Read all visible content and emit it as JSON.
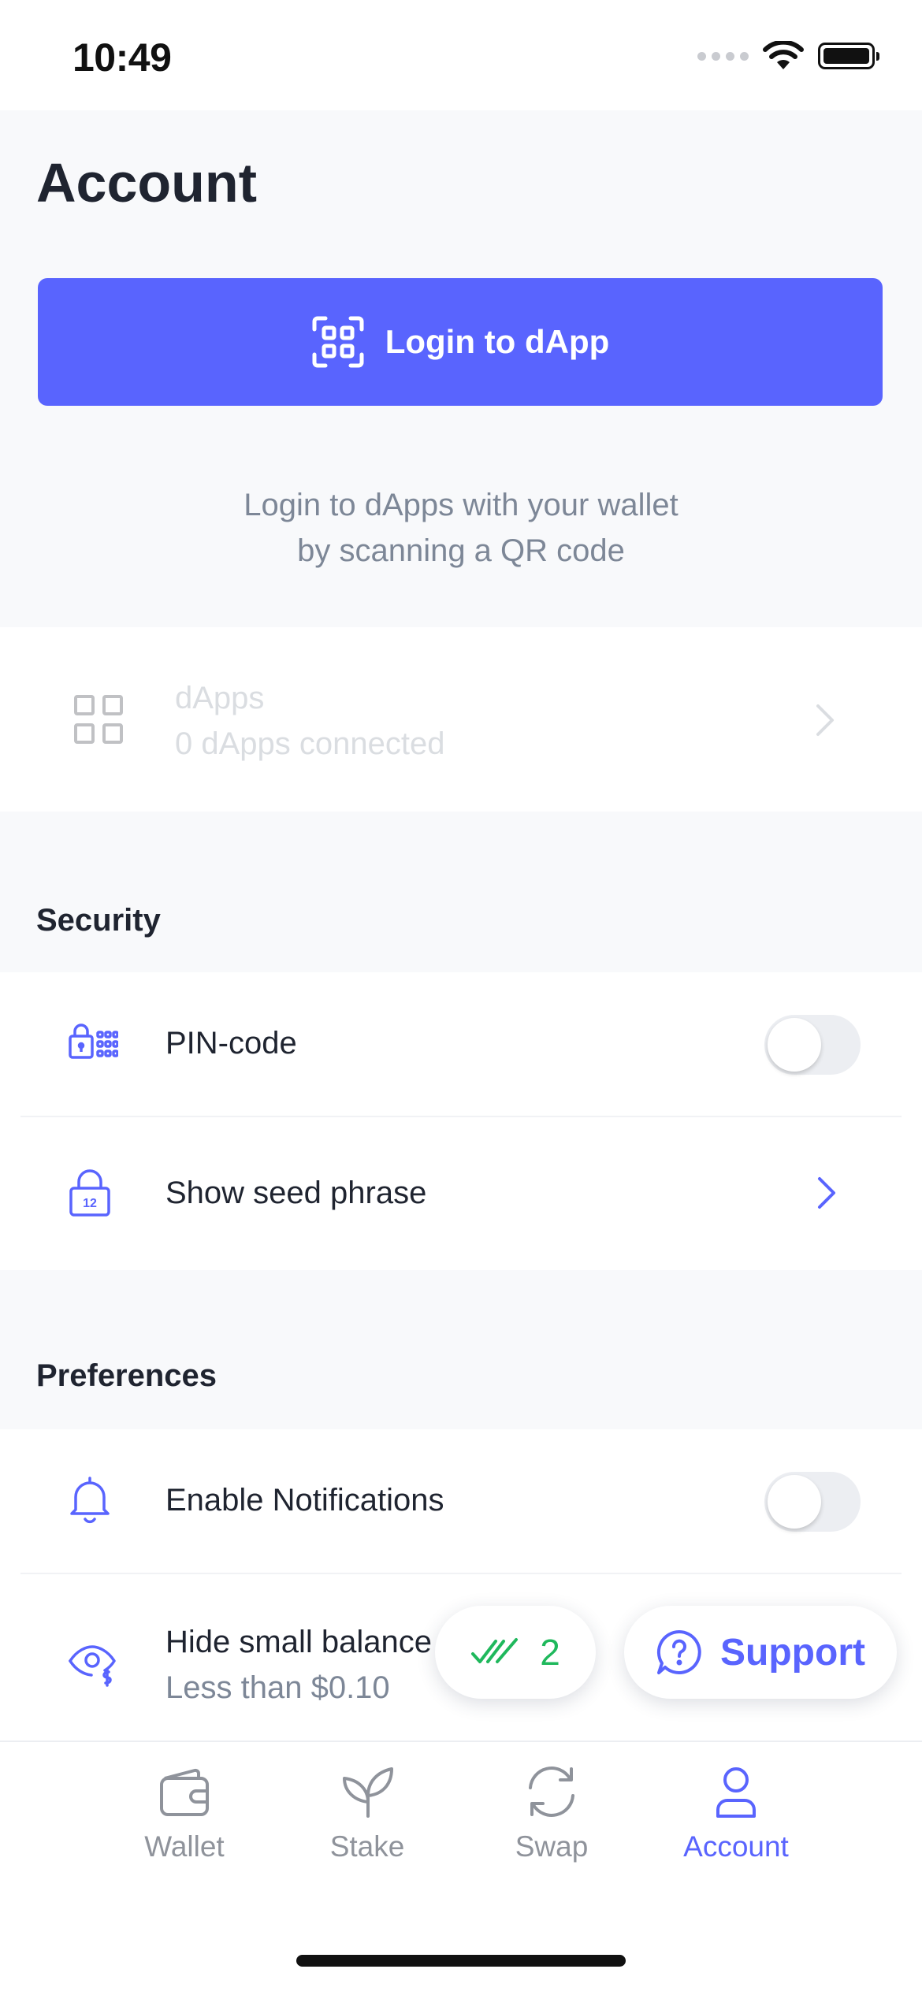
{
  "status_bar": {
    "time": "10:49"
  },
  "header": {
    "title": "Account",
    "login_button_label": "Login to dApp",
    "login_hint_line1": "Login to dApps with your wallet",
    "login_hint_line2": "by scanning a QR code"
  },
  "dapps": {
    "title": "dApps",
    "subtitle": "0 dApps connected",
    "enabled": false
  },
  "security": {
    "title": "Security",
    "items": [
      {
        "label": "PIN-code",
        "control": "toggle",
        "on": false
      },
      {
        "label": "Show seed phrase",
        "control": "chevron",
        "icon_badge": "12"
      }
    ]
  },
  "preferences": {
    "title": "Preferences",
    "items": [
      {
        "label": "Enable Notifications",
        "control": "toggle",
        "on": false
      },
      {
        "label": "Hide small balance",
        "sublabel": "Less than $0.10"
      }
    ]
  },
  "floating": {
    "tx_count": "2",
    "support_label": "Support"
  },
  "tab_bar": {
    "tabs": [
      {
        "label": "Wallet",
        "icon": "wallet-icon",
        "active": false
      },
      {
        "label": "Stake",
        "icon": "sprout-icon",
        "active": false
      },
      {
        "label": "Swap",
        "icon": "swap-icon",
        "active": false
      },
      {
        "label": "Account",
        "icon": "user-icon",
        "active": true
      }
    ]
  },
  "colors": {
    "accent": "#5964fe",
    "success": "#1fb85c",
    "muted": "#7d8797",
    "section_bg": "#f8f9fb"
  }
}
